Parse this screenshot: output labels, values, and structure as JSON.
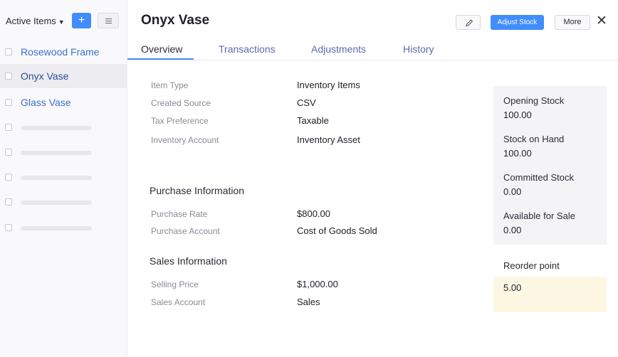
{
  "sidebar": {
    "filter_label": "Active Items",
    "add_label": "+",
    "items": [
      {
        "label": "Rosewood Frame"
      },
      {
        "label": "Onyx Vase"
      },
      {
        "label": "Glass Vase"
      }
    ]
  },
  "header": {
    "title": "Onyx Vase",
    "adjust_label": "Adjust Stock",
    "more_label": "More",
    "close_label": "✕"
  },
  "tabs": [
    "Overview",
    "Transactions",
    "Adjustments",
    "History"
  ],
  "details": {
    "rows": [
      {
        "label": "Item Type",
        "value": "Inventory Items"
      },
      {
        "label": "Created Source",
        "value": "CSV"
      },
      {
        "label": "Tax Preference",
        "value": "Taxable"
      },
      {
        "label": "Inventory Account",
        "value": "Inventory Asset"
      }
    ],
    "purchase": {
      "title": "Purchase Information",
      "rows": [
        {
          "label": "Purchase Rate",
          "value": "$800.00"
        },
        {
          "label": "Purchase Account",
          "value": "Cost of Goods Sold"
        }
      ]
    },
    "sales": {
      "title": "Sales Information",
      "rows": [
        {
          "label": "Selling Price",
          "value": "$1,000.00"
        },
        {
          "label": "Sales Account",
          "value": "Sales"
        }
      ]
    }
  },
  "stock": {
    "items": [
      {
        "label": "Opening Stock",
        "value": "100.00"
      },
      {
        "label": "Stock on Hand",
        "value": "100.00"
      },
      {
        "label": "Committed Stock",
        "value": "0.00"
      },
      {
        "label": "Available for Sale",
        "value": "0.00"
      }
    ],
    "reorder_label": "Reorder point",
    "reorder_value": "5.00"
  },
  "colors": {
    "accent": "#408dfb",
    "link": "#3c6fcc",
    "reorder_bg": "#fbf7e3",
    "panel_bg": "#f4f4f7"
  },
  "icons": [
    "plus-icon",
    "hamburger-menu-icon",
    "pencil-icon",
    "close-icon",
    "caret-down-icon"
  ]
}
